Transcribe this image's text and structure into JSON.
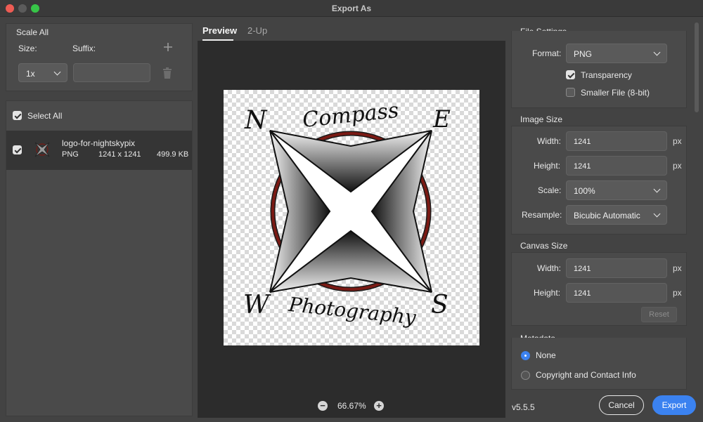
{
  "window": {
    "title": "Export As"
  },
  "scale_all": {
    "heading": "Scale All",
    "size_label": "Size:",
    "suffix_label": "Suffix:",
    "size_value": "1x",
    "suffix_value": "",
    "add_icon": "plus-icon",
    "delete_icon": "trash-icon"
  },
  "assets": {
    "select_all_label": "Select All",
    "select_all_checked": true,
    "items": [
      {
        "name": "logo-for-nightskypix",
        "format": "PNG",
        "dimensions": "1241 x 1241",
        "size": "499.9 KB",
        "checked": true
      }
    ]
  },
  "preview": {
    "tabs": [
      "Preview",
      "2-Up"
    ],
    "active_tab": "Preview",
    "zoom": "66.67%",
    "logo_text": {
      "n": "N",
      "e": "E",
      "w": "W",
      "s": "S",
      "top": "Compass",
      "bottom": "Photography"
    }
  },
  "file_settings": {
    "heading": "File Settings",
    "format_label": "Format:",
    "format_value": "PNG",
    "transparency_label": "Transparency",
    "transparency_checked": true,
    "smaller_file_label": "Smaller File (8-bit)",
    "smaller_file_checked": false
  },
  "image_size": {
    "heading": "Image Size",
    "width_label": "Width:",
    "width_value": "1241",
    "height_label": "Height:",
    "height_value": "1241",
    "unit": "px",
    "scale_label": "Scale:",
    "scale_value": "100%",
    "resample_label": "Resample:",
    "resample_value": "Bicubic Automatic"
  },
  "canvas_size": {
    "heading": "Canvas Size",
    "width_label": "Width:",
    "width_value": "1241",
    "height_label": "Height:",
    "height_value": "1241",
    "unit": "px",
    "reset_label": "Reset"
  },
  "metadata": {
    "heading": "Metadata",
    "options": [
      "None",
      "Copyright and Contact Info"
    ],
    "selected": "None"
  },
  "footer": {
    "version": "v5.5.5",
    "cancel_label": "Cancel",
    "export_label": "Export"
  },
  "colors": {
    "accent": "#3b82f0",
    "logo_ring": "#7a1a14",
    "window_bg": "#434343"
  }
}
